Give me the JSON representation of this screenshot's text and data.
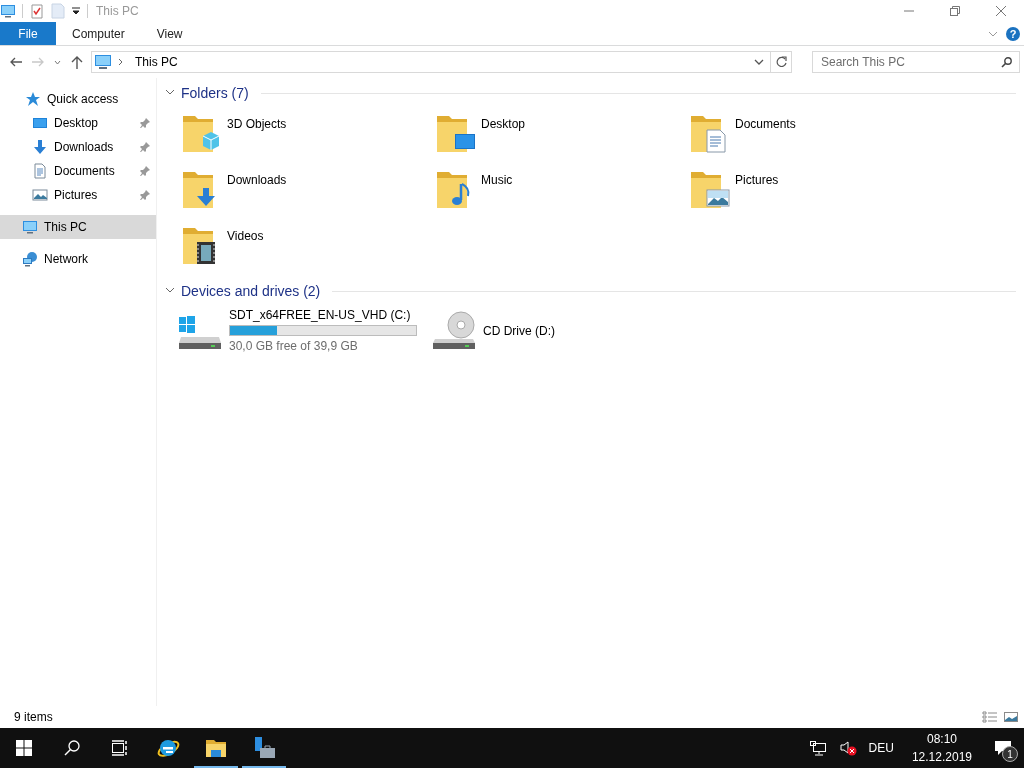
{
  "window": {
    "title": "This PC"
  },
  "ribbon": {
    "tabs": [
      {
        "label": "File",
        "selected": true
      },
      {
        "label": "Computer",
        "selected": false
      },
      {
        "label": "View",
        "selected": false
      }
    ],
    "help": "?"
  },
  "address_bar": {
    "location": "This PC"
  },
  "search": {
    "placeholder": "Search This PC"
  },
  "sidebar": {
    "items": [
      {
        "label": "Quick access",
        "kind": "star",
        "selected": false,
        "children": [
          {
            "label": "Desktop",
            "kind": "desktop",
            "selected": false,
            "pinned": true
          },
          {
            "label": "Downloads",
            "kind": "download",
            "selected": false,
            "pinned": true
          },
          {
            "label": "Documents",
            "kind": "document",
            "selected": false,
            "pinned": true
          },
          {
            "label": "Pictures",
            "kind": "picture",
            "selected": false,
            "pinned": true
          }
        ]
      },
      {
        "label": "This PC",
        "kind": "pc",
        "selected": true
      },
      {
        "label": "Network",
        "kind": "network",
        "selected": false
      }
    ]
  },
  "sections": [
    {
      "title": "Folders (7)",
      "expanded": true,
      "items": [
        {
          "label": "3D Objects",
          "kind": "objects3d"
        },
        {
          "label": "Desktop",
          "kind": "desktop"
        },
        {
          "label": "Documents",
          "kind": "documents"
        },
        {
          "label": "Downloads",
          "kind": "downloads"
        },
        {
          "label": "Music",
          "kind": "music"
        },
        {
          "label": "Pictures",
          "kind": "pictures"
        },
        {
          "label": "Videos",
          "kind": "videos"
        }
      ]
    },
    {
      "title": "Devices and drives (2)",
      "expanded": true,
      "items": [
        {
          "label": "SDT_x64FREE_EN-US_VHD (C:)",
          "kind": "disk",
          "level": 0.25,
          "reading": "30,0 GB free of 39,9 GB"
        },
        {
          "label": "CD Drive (D:)",
          "kind": "cd"
        }
      ]
    }
  ],
  "status_bar": {
    "text": "9 items"
  },
  "taskbar": {
    "apps": [
      {
        "kind": "ie",
        "running": false
      },
      {
        "kind": "explorer",
        "running": true
      },
      {
        "kind": "server",
        "running": true
      }
    ],
    "language": "DEU",
    "time": "08:10",
    "date": "12.12.2019",
    "notification_count": "1"
  }
}
